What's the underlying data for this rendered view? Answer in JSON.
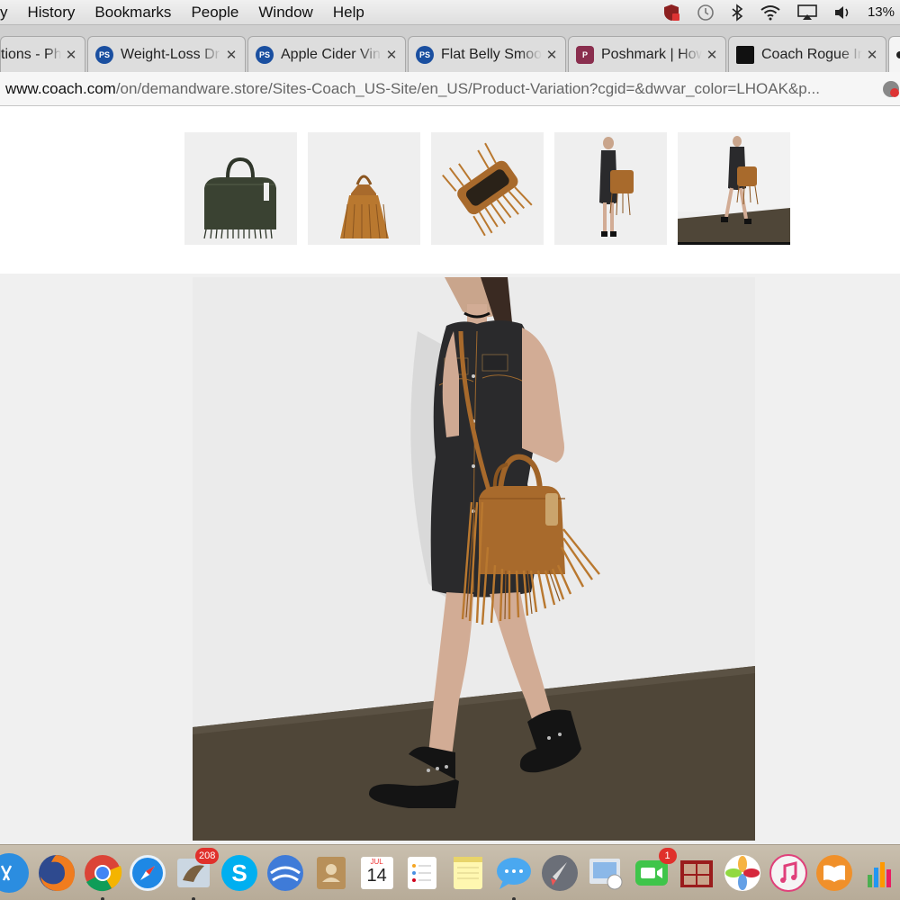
{
  "menubar": {
    "items": [
      "y",
      "History",
      "Bookmarks",
      "People",
      "Window",
      "Help"
    ],
    "battery": "13%"
  },
  "tabs": [
    {
      "title": "tions - Ph",
      "icon": "page-icon",
      "partial": true
    },
    {
      "title": "Weight-Loss Dr",
      "icon": "ps-favicon"
    },
    {
      "title": "Apple Cider Vin",
      "icon": "ps-favicon"
    },
    {
      "title": "Flat Belly Smoo",
      "icon": "ps-favicon"
    },
    {
      "title": "Poshmark | How",
      "icon": "poshmark-favicon"
    },
    {
      "title": "Coach Rogue In",
      "icon": "coach-favicon"
    }
  ],
  "address": {
    "host": "www.coach.com",
    "path": "/on/demandware.store/Sites-Coach_US-Site/en_US/Product-Variation?cgid=&dwvar_color=LHOAK&p..."
  },
  "dock": {
    "mail_badge": "208",
    "facetime_badge": "1",
    "calendar_month": "JUL",
    "calendar_day": "14"
  },
  "colors": {
    "bag_brown": "#a86a2c",
    "bag_green": "#3a4232",
    "dress": "#2a2a2c",
    "floor": "#4f4638"
  }
}
